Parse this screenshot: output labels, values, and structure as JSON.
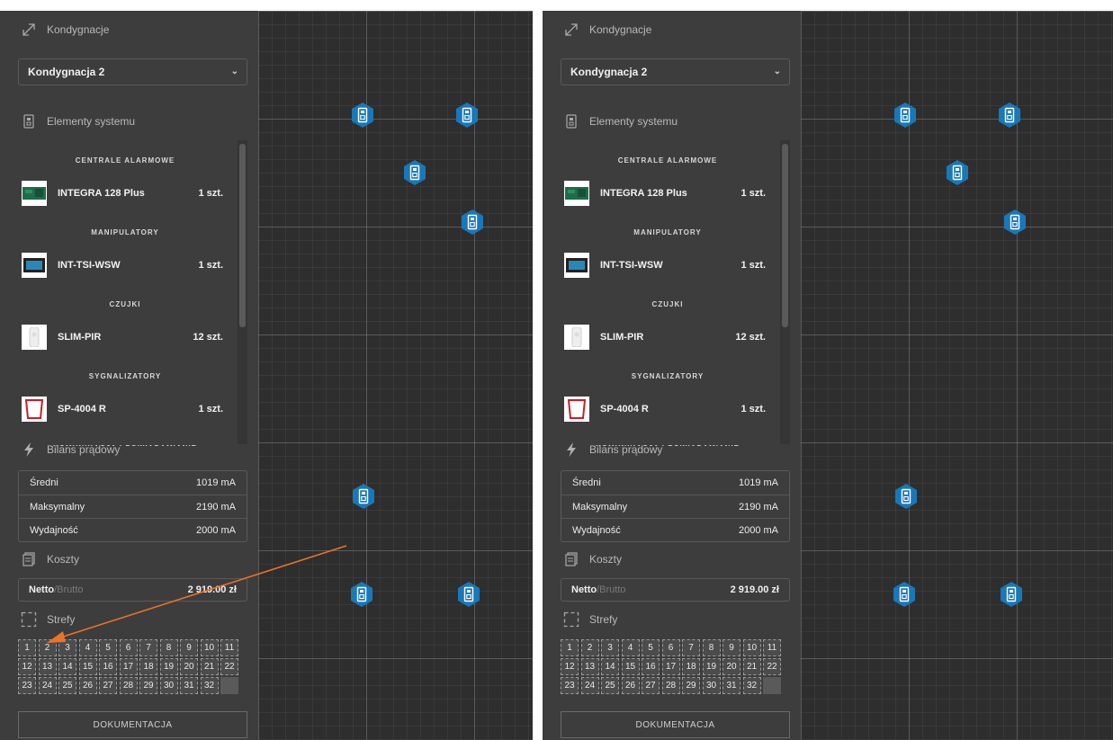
{
  "sidebar": {
    "floors": {
      "title": "Kondygnacje",
      "icon": "diagonal-arrows-icon",
      "selected": "Kondygnacja 2"
    },
    "elements": {
      "title": "Elementy systemu",
      "icon": "device-icon",
      "categories": [
        {
          "label": "CENTRALE ALARMOWE",
          "items": [
            {
              "name": "INTEGRA 128 Plus",
              "qty": "1 szt.",
              "icon": "control-panel-thumbnail"
            }
          ]
        },
        {
          "label": "MANIPULATORY",
          "items": [
            {
              "name": "INT-TSI-WSW",
              "qty": "1 szt.",
              "icon": "keypad-thumbnail"
            }
          ]
        },
        {
          "label": "CZUJKI",
          "items": [
            {
              "name": "SLIM-PIR",
              "qty": "12 szt.",
              "icon": "pir-detector-thumbnail"
            }
          ]
        },
        {
          "label": "SYGNALIZATORY",
          "items": [
            {
              "name": "SP-4004 R",
              "qty": "1 szt.",
              "icon": "siren-thumbnail"
            }
          ]
        },
        {
          "label": "KOMUNIKACJA I POWIADAMIANIE",
          "items": []
        }
      ]
    },
    "power": {
      "title": "Bilans prądowy",
      "icon": "lightning-icon",
      "rows": [
        {
          "label": "Średni",
          "value": "1019 mA"
        },
        {
          "label": "Maksymalny",
          "value": "2190 mA"
        },
        {
          "label": "Wydajność",
          "value": "2000 mA"
        }
      ]
    },
    "costs": {
      "title": "Koszty",
      "icon": "documents-icon",
      "netto": "Netto",
      "brutto": "/Brutto",
      "value": "2 919.00 zł"
    },
    "zones": {
      "title": "Strefy",
      "icon": "dashed-square-icon",
      "items": [
        "1",
        "2",
        "3",
        "4",
        "5",
        "6",
        "7",
        "8",
        "9",
        "10",
        "11",
        "12",
        "13",
        "14",
        "15",
        "16",
        "17",
        "18",
        "19",
        "20",
        "21",
        "22",
        "23",
        "24",
        "25",
        "26",
        "27",
        "28",
        "29",
        "30",
        "31",
        "32"
      ]
    },
    "documentation_label": "DOKUMENTACJA"
  },
  "canvas": {
    "device_icon": "detector-hexagon-icon",
    "device_color": "#1a78b8"
  },
  "annotation": {
    "arrow_color": "#e8742d",
    "points_to": "zone 2"
  }
}
